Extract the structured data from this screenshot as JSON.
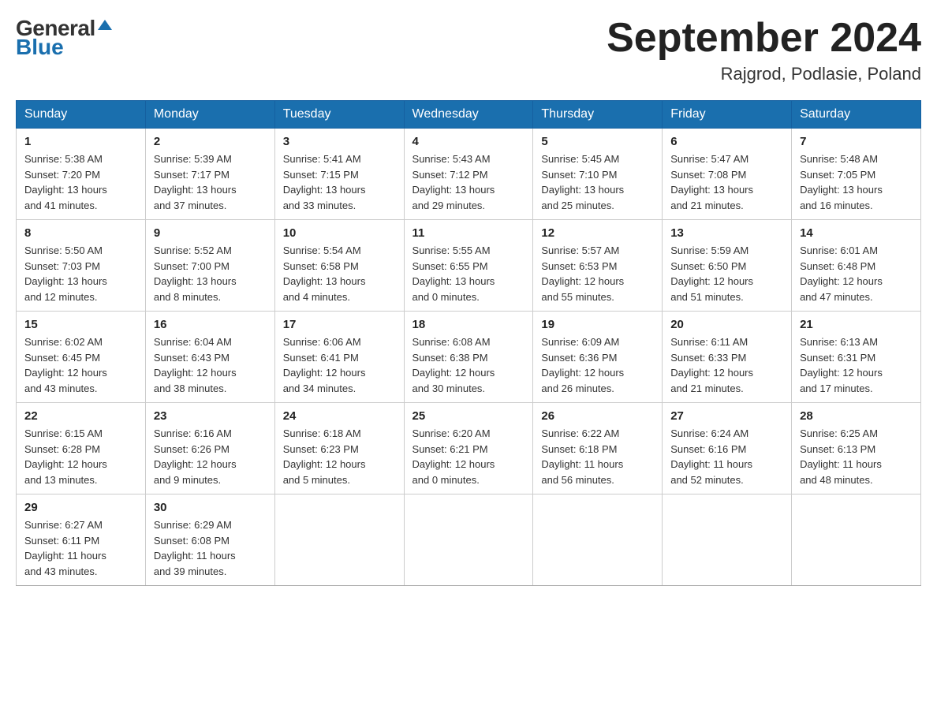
{
  "logo": {
    "general": "General",
    "blue": "Blue",
    "arrow": "▲"
  },
  "header": {
    "month": "September 2024",
    "location": "Rajgrod, Podlasie, Poland"
  },
  "weekdays": [
    "Sunday",
    "Monday",
    "Tuesday",
    "Wednesday",
    "Thursday",
    "Friday",
    "Saturday"
  ],
  "weeks": [
    [
      {
        "day": "1",
        "info": "Sunrise: 5:38 AM\nSunset: 7:20 PM\nDaylight: 13 hours\nand 41 minutes."
      },
      {
        "day": "2",
        "info": "Sunrise: 5:39 AM\nSunset: 7:17 PM\nDaylight: 13 hours\nand 37 minutes."
      },
      {
        "day": "3",
        "info": "Sunrise: 5:41 AM\nSunset: 7:15 PM\nDaylight: 13 hours\nand 33 minutes."
      },
      {
        "day": "4",
        "info": "Sunrise: 5:43 AM\nSunset: 7:12 PM\nDaylight: 13 hours\nand 29 minutes."
      },
      {
        "day": "5",
        "info": "Sunrise: 5:45 AM\nSunset: 7:10 PM\nDaylight: 13 hours\nand 25 minutes."
      },
      {
        "day": "6",
        "info": "Sunrise: 5:47 AM\nSunset: 7:08 PM\nDaylight: 13 hours\nand 21 minutes."
      },
      {
        "day": "7",
        "info": "Sunrise: 5:48 AM\nSunset: 7:05 PM\nDaylight: 13 hours\nand 16 minutes."
      }
    ],
    [
      {
        "day": "8",
        "info": "Sunrise: 5:50 AM\nSunset: 7:03 PM\nDaylight: 13 hours\nand 12 minutes."
      },
      {
        "day": "9",
        "info": "Sunrise: 5:52 AM\nSunset: 7:00 PM\nDaylight: 13 hours\nand 8 minutes."
      },
      {
        "day": "10",
        "info": "Sunrise: 5:54 AM\nSunset: 6:58 PM\nDaylight: 13 hours\nand 4 minutes."
      },
      {
        "day": "11",
        "info": "Sunrise: 5:55 AM\nSunset: 6:55 PM\nDaylight: 13 hours\nand 0 minutes."
      },
      {
        "day": "12",
        "info": "Sunrise: 5:57 AM\nSunset: 6:53 PM\nDaylight: 12 hours\nand 55 minutes."
      },
      {
        "day": "13",
        "info": "Sunrise: 5:59 AM\nSunset: 6:50 PM\nDaylight: 12 hours\nand 51 minutes."
      },
      {
        "day": "14",
        "info": "Sunrise: 6:01 AM\nSunset: 6:48 PM\nDaylight: 12 hours\nand 47 minutes."
      }
    ],
    [
      {
        "day": "15",
        "info": "Sunrise: 6:02 AM\nSunset: 6:45 PM\nDaylight: 12 hours\nand 43 minutes."
      },
      {
        "day": "16",
        "info": "Sunrise: 6:04 AM\nSunset: 6:43 PM\nDaylight: 12 hours\nand 38 minutes."
      },
      {
        "day": "17",
        "info": "Sunrise: 6:06 AM\nSunset: 6:41 PM\nDaylight: 12 hours\nand 34 minutes."
      },
      {
        "day": "18",
        "info": "Sunrise: 6:08 AM\nSunset: 6:38 PM\nDaylight: 12 hours\nand 30 minutes."
      },
      {
        "day": "19",
        "info": "Sunrise: 6:09 AM\nSunset: 6:36 PM\nDaylight: 12 hours\nand 26 minutes."
      },
      {
        "day": "20",
        "info": "Sunrise: 6:11 AM\nSunset: 6:33 PM\nDaylight: 12 hours\nand 21 minutes."
      },
      {
        "day": "21",
        "info": "Sunrise: 6:13 AM\nSunset: 6:31 PM\nDaylight: 12 hours\nand 17 minutes."
      }
    ],
    [
      {
        "day": "22",
        "info": "Sunrise: 6:15 AM\nSunset: 6:28 PM\nDaylight: 12 hours\nand 13 minutes."
      },
      {
        "day": "23",
        "info": "Sunrise: 6:16 AM\nSunset: 6:26 PM\nDaylight: 12 hours\nand 9 minutes."
      },
      {
        "day": "24",
        "info": "Sunrise: 6:18 AM\nSunset: 6:23 PM\nDaylight: 12 hours\nand 5 minutes."
      },
      {
        "day": "25",
        "info": "Sunrise: 6:20 AM\nSunset: 6:21 PM\nDaylight: 12 hours\nand 0 minutes."
      },
      {
        "day": "26",
        "info": "Sunrise: 6:22 AM\nSunset: 6:18 PM\nDaylight: 11 hours\nand 56 minutes."
      },
      {
        "day": "27",
        "info": "Sunrise: 6:24 AM\nSunset: 6:16 PM\nDaylight: 11 hours\nand 52 minutes."
      },
      {
        "day": "28",
        "info": "Sunrise: 6:25 AM\nSunset: 6:13 PM\nDaylight: 11 hours\nand 48 minutes."
      }
    ],
    [
      {
        "day": "29",
        "info": "Sunrise: 6:27 AM\nSunset: 6:11 PM\nDaylight: 11 hours\nand 43 minutes."
      },
      {
        "day": "30",
        "info": "Sunrise: 6:29 AM\nSunset: 6:08 PM\nDaylight: 11 hours\nand 39 minutes."
      },
      {
        "day": "",
        "info": ""
      },
      {
        "day": "",
        "info": ""
      },
      {
        "day": "",
        "info": ""
      },
      {
        "day": "",
        "info": ""
      },
      {
        "day": "",
        "info": ""
      }
    ]
  ]
}
